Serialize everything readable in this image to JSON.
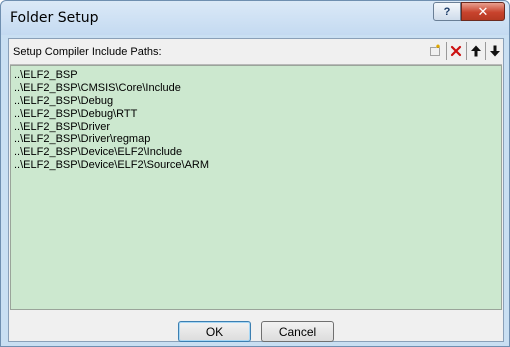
{
  "window": {
    "title": "Folder Setup",
    "help_label": "?",
    "close_label": "✕"
  },
  "list": {
    "header_label": "Setup Compiler Include Paths:",
    "toolbar_icons": [
      "new-folder-icon",
      "delete-icon",
      "move-up-icon",
      "move-down-icon"
    ],
    "items": [
      "..\\ELF2_BSP",
      "..\\ELF2_BSP\\CMSIS\\Core\\Include",
      "..\\ELF2_BSP\\Debug",
      "..\\ELF2_BSP\\Debug\\RTT",
      "..\\ELF2_BSP\\Driver",
      "..\\ELF2_BSP\\Driver\\regmap",
      "..\\ELF2_BSP\\Device\\ELF2\\Include",
      "..\\ELF2_BSP\\Device\\ELF2\\Source\\ARM"
    ]
  },
  "buttons": {
    "ok_label": "OK",
    "cancel_label": "Cancel"
  },
  "colors": {
    "list_background": "#cce8cf",
    "title_bar": "#c9dff2",
    "close_button": "#c8432d"
  }
}
